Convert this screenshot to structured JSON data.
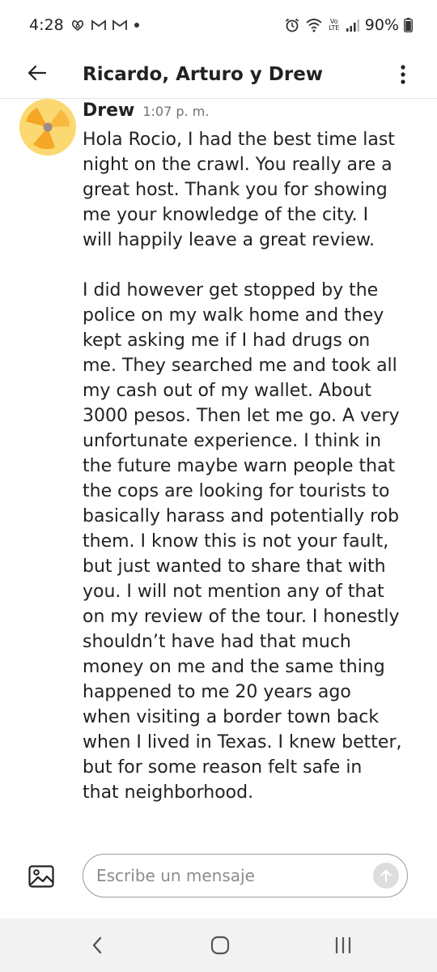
{
  "status_bar": {
    "time": "4:28",
    "battery": "90%",
    "net_label": "Vo LTE"
  },
  "app_bar": {
    "title": "Ricardo, Arturo y Drew"
  },
  "message": {
    "sender": "Drew",
    "time": "1:07 p. m.",
    "paragraphs": [
      [
        "Hola Rocio, I had the best time last",
        "night on the crawl. You really are a",
        "great host. Thank you for showing",
        "me your knowledge of the city. I",
        "will happily leave a great review."
      ],
      [
        "I did however get stopped by the",
        "police on my walk home and they",
        "kept asking me if I had drugs on",
        "me. They searched me and took all",
        "my cash out of my wallet. About",
        "3000 pesos. Then let me go. A very",
        "unfortunate experience. I think in",
        "the future maybe warn people that",
        "the cops are looking for tourists to",
        "basically harass and potentially rob",
        "them. I know this is not your fault,",
        "but just wanted to share that with",
        "you. I will not mention any of that",
        "on my review of the tour. I honestly",
        "shouldn’t have had that much",
        "money on me and the same thing",
        "happened to me 20 years ago",
        "when visiting a border town back",
        "when I lived in Texas. I knew better,",
        "but for some reason felt safe in",
        "that neighborhood."
      ]
    ]
  },
  "composer": {
    "placeholder": "Escribe un mensaje",
    "value": ""
  },
  "colors": {
    "avatar_bg": "#fbd872",
    "avatar_blades": "#f5a623",
    "avatar_hub": "#a08a86",
    "text": "#222222",
    "muted": "#717171",
    "send_bg": "#dddddd",
    "nav_bg": "#f2f2f2"
  },
  "icons": {
    "back": "arrow-left-icon",
    "more": "more-vertical-icon",
    "photo": "image-icon",
    "send": "arrow-up-icon",
    "nav_back": "chevron-left-icon",
    "nav_home": "home-icon",
    "nav_recents": "recents-icon"
  }
}
